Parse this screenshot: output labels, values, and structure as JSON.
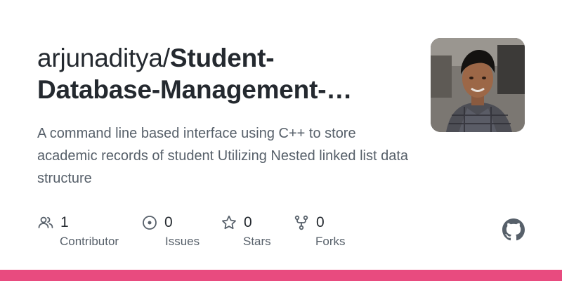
{
  "repo": {
    "owner": "arjunaditya/",
    "name_line1": "Student-",
    "name_line2": "Database-Management-…"
  },
  "description": "A command line based interface using C++ to store academic records of student Utilizing Nested linked list data structure",
  "stats": [
    {
      "icon": "people-icon",
      "count": "1",
      "label": "Contributor"
    },
    {
      "icon": "issue-icon",
      "count": "0",
      "label": "Issues"
    },
    {
      "icon": "star-icon",
      "count": "0",
      "label": "Stars"
    },
    {
      "icon": "fork-icon",
      "count": "0",
      "label": "Forks"
    }
  ],
  "brand": {
    "logo_icon": "github-mark-icon",
    "accent_bar_color": "#e84b7f"
  }
}
